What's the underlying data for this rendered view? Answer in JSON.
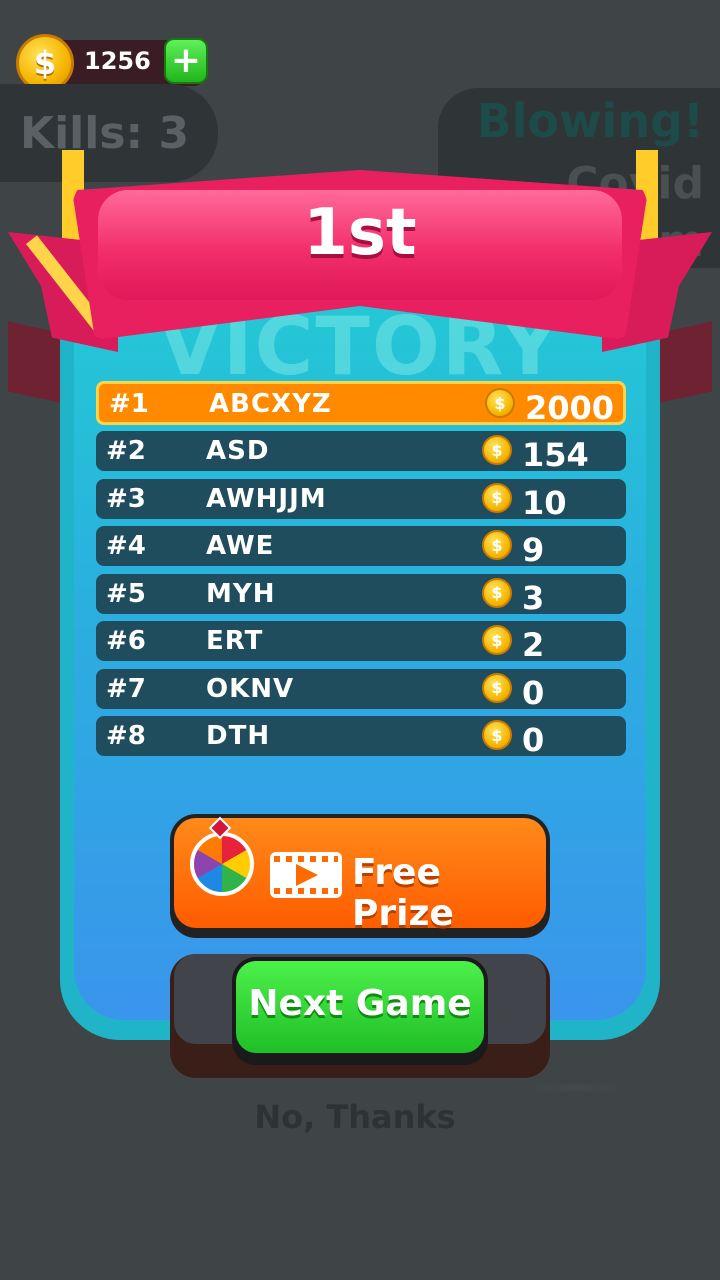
{
  "hud": {
    "coins": "1256",
    "coin_symbol": "$",
    "plus_label": "+",
    "kills": "Kills: 3"
  },
  "status": {
    "line1": "Blowing!",
    "line2": "Covid",
    "line3": "m"
  },
  "result": {
    "place": "1st",
    "watermark": "VICTORY"
  },
  "leaderboard": [
    {
      "rank": "#1",
      "name": "ABCXYZ",
      "coins": "2000"
    },
    {
      "rank": "#2",
      "name": "ASD",
      "coins": "154"
    },
    {
      "rank": "#3",
      "name": "AWHJJM",
      "coins": "10"
    },
    {
      "rank": "#4",
      "name": "AWE",
      "coins": "9"
    },
    {
      "rank": "#5",
      "name": "MYH",
      "coins": "3"
    },
    {
      "rank": "#6",
      "name": "ERT",
      "coins": "2"
    },
    {
      "rank": "#7",
      "name": "OKNV",
      "coins": "0"
    },
    {
      "rank": "#8",
      "name": "DTH",
      "coins": "0"
    }
  ],
  "buttons": {
    "free_prize": "Free Prize",
    "next_game": "Next Game",
    "no_thanks": "No, Thanks"
  },
  "colors": {
    "background": "#3f4547",
    "ribbon": "#e8205f",
    "panel": "#23c9d4",
    "first_row": "#ff8a00",
    "row": "#1f4d5d",
    "free_prize": "#ff5c00",
    "next_game": "#1fbf27"
  }
}
